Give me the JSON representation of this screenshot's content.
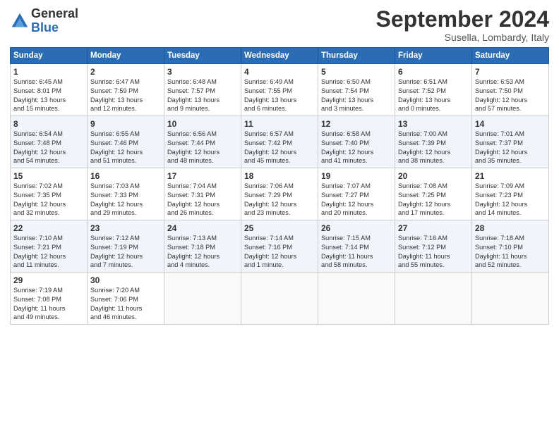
{
  "logo": {
    "general": "General",
    "blue": "Blue"
  },
  "title": "September 2024",
  "subtitle": "Susella, Lombardy, Italy",
  "days_header": [
    "Sunday",
    "Monday",
    "Tuesday",
    "Wednesday",
    "Thursday",
    "Friday",
    "Saturday"
  ],
  "weeks": [
    [
      {
        "day": "1",
        "info": "Sunrise: 6:45 AM\nSunset: 8:01 PM\nDaylight: 13 hours\nand 15 minutes."
      },
      {
        "day": "2",
        "info": "Sunrise: 6:47 AM\nSunset: 7:59 PM\nDaylight: 13 hours\nand 12 minutes."
      },
      {
        "day": "3",
        "info": "Sunrise: 6:48 AM\nSunset: 7:57 PM\nDaylight: 13 hours\nand 9 minutes."
      },
      {
        "day": "4",
        "info": "Sunrise: 6:49 AM\nSunset: 7:55 PM\nDaylight: 13 hours\nand 6 minutes."
      },
      {
        "day": "5",
        "info": "Sunrise: 6:50 AM\nSunset: 7:54 PM\nDaylight: 13 hours\nand 3 minutes."
      },
      {
        "day": "6",
        "info": "Sunrise: 6:51 AM\nSunset: 7:52 PM\nDaylight: 13 hours\nand 0 minutes."
      },
      {
        "day": "7",
        "info": "Sunrise: 6:53 AM\nSunset: 7:50 PM\nDaylight: 12 hours\nand 57 minutes."
      }
    ],
    [
      {
        "day": "8",
        "info": "Sunrise: 6:54 AM\nSunset: 7:48 PM\nDaylight: 12 hours\nand 54 minutes."
      },
      {
        "day": "9",
        "info": "Sunrise: 6:55 AM\nSunset: 7:46 PM\nDaylight: 12 hours\nand 51 minutes."
      },
      {
        "day": "10",
        "info": "Sunrise: 6:56 AM\nSunset: 7:44 PM\nDaylight: 12 hours\nand 48 minutes."
      },
      {
        "day": "11",
        "info": "Sunrise: 6:57 AM\nSunset: 7:42 PM\nDaylight: 12 hours\nand 45 minutes."
      },
      {
        "day": "12",
        "info": "Sunrise: 6:58 AM\nSunset: 7:40 PM\nDaylight: 12 hours\nand 41 minutes."
      },
      {
        "day": "13",
        "info": "Sunrise: 7:00 AM\nSunset: 7:39 PM\nDaylight: 12 hours\nand 38 minutes."
      },
      {
        "day": "14",
        "info": "Sunrise: 7:01 AM\nSunset: 7:37 PM\nDaylight: 12 hours\nand 35 minutes."
      }
    ],
    [
      {
        "day": "15",
        "info": "Sunrise: 7:02 AM\nSunset: 7:35 PM\nDaylight: 12 hours\nand 32 minutes."
      },
      {
        "day": "16",
        "info": "Sunrise: 7:03 AM\nSunset: 7:33 PM\nDaylight: 12 hours\nand 29 minutes."
      },
      {
        "day": "17",
        "info": "Sunrise: 7:04 AM\nSunset: 7:31 PM\nDaylight: 12 hours\nand 26 minutes."
      },
      {
        "day": "18",
        "info": "Sunrise: 7:06 AM\nSunset: 7:29 PM\nDaylight: 12 hours\nand 23 minutes."
      },
      {
        "day": "19",
        "info": "Sunrise: 7:07 AM\nSunset: 7:27 PM\nDaylight: 12 hours\nand 20 minutes."
      },
      {
        "day": "20",
        "info": "Sunrise: 7:08 AM\nSunset: 7:25 PM\nDaylight: 12 hours\nand 17 minutes."
      },
      {
        "day": "21",
        "info": "Sunrise: 7:09 AM\nSunset: 7:23 PM\nDaylight: 12 hours\nand 14 minutes."
      }
    ],
    [
      {
        "day": "22",
        "info": "Sunrise: 7:10 AM\nSunset: 7:21 PM\nDaylight: 12 hours\nand 11 minutes."
      },
      {
        "day": "23",
        "info": "Sunrise: 7:12 AM\nSunset: 7:19 PM\nDaylight: 12 hours\nand 7 minutes."
      },
      {
        "day": "24",
        "info": "Sunrise: 7:13 AM\nSunset: 7:18 PM\nDaylight: 12 hours\nand 4 minutes."
      },
      {
        "day": "25",
        "info": "Sunrise: 7:14 AM\nSunset: 7:16 PM\nDaylight: 12 hours\nand 1 minute."
      },
      {
        "day": "26",
        "info": "Sunrise: 7:15 AM\nSunset: 7:14 PM\nDaylight: 11 hours\nand 58 minutes."
      },
      {
        "day": "27",
        "info": "Sunrise: 7:16 AM\nSunset: 7:12 PM\nDaylight: 11 hours\nand 55 minutes."
      },
      {
        "day": "28",
        "info": "Sunrise: 7:18 AM\nSunset: 7:10 PM\nDaylight: 11 hours\nand 52 minutes."
      }
    ],
    [
      {
        "day": "29",
        "info": "Sunrise: 7:19 AM\nSunset: 7:08 PM\nDaylight: 11 hours\nand 49 minutes."
      },
      {
        "day": "30",
        "info": "Sunrise: 7:20 AM\nSunset: 7:06 PM\nDaylight: 11 hours\nand 46 minutes."
      },
      {
        "day": "",
        "info": ""
      },
      {
        "day": "",
        "info": ""
      },
      {
        "day": "",
        "info": ""
      },
      {
        "day": "",
        "info": ""
      },
      {
        "day": "",
        "info": ""
      }
    ]
  ]
}
